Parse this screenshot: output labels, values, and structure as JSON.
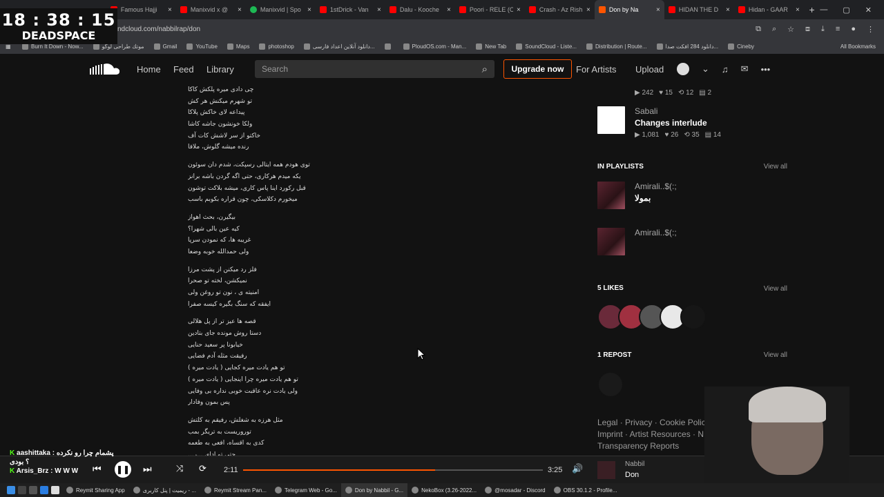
{
  "tabs": [
    {
      "label": "Famous Hajji",
      "icon": "youtube-icon",
      "close": "×"
    },
    {
      "label": "Manixvid x @",
      "icon": "youtube-icon",
      "close": "×"
    },
    {
      "label": "Manixvid | Spo",
      "icon": "spotify-icon",
      "close": "×"
    },
    {
      "label": "1stDrick - Van",
      "icon": "youtube-icon",
      "close": "×"
    },
    {
      "label": "Dalu - Kooche",
      "icon": "youtube-icon",
      "close": "×"
    },
    {
      "label": "Poori - RELE (O",
      "icon": "youtube-icon",
      "close": "×"
    },
    {
      "label": "Crash - Az Rish",
      "icon": "youtube-icon",
      "close": "×"
    },
    {
      "label": "Don by Na",
      "icon": "soundcloud-icon",
      "close": "×",
      "active": true
    },
    {
      "label": "HIDAN THE D",
      "icon": "youtube-icon",
      "close": "×"
    },
    {
      "label": "Hidan - GAAR",
      "icon": "youtube-icon",
      "close": "×"
    }
  ],
  "new_tab": "+",
  "url": "ndcloud.com/nabbilrap/don",
  "bookmarks": [
    "Burn It Down - Now...",
    "موتك طراحی لوگو",
    "Gmail",
    "YouTube",
    "Maps",
    "photoshop",
    "دانلود آنلاین اعداد فارسی...",
    "",
    "PloudOS.com - Man...",
    "New Tab",
    "SoundCloud - Liste...",
    "Distribution | Route...",
    "دانلود 284 افکت صدا...",
    "Cineby"
  ],
  "all_bookmarks": "All Bookmarks",
  "clock": {
    "time": "18 : 38 : 15",
    "label": "DEADSPACE"
  },
  "nav": {
    "home": "Home",
    "feed": "Feed",
    "library": "Library",
    "for_artists": "For Artists",
    "upload": "Upload"
  },
  "search": {
    "placeholder": "Search"
  },
  "upgrade": "Upgrade now",
  "lyrics": [
    [
      "چی دادی میره پلکش کاکا",
      "تو شهرم میکنش هر کش",
      "پیداعه لای خاکش پلاکا",
      "ولکا خونشون جاشه کاشا",
      "خاکتو از سر لاشش کات آف",
      "رنده میشه گلوش، ملافا"
    ],
    [
      "توی هودم همه ایتالی رسپکت، شدم دان سوئون",
      "یکه میدم هرکاری، حتی اگه گردن باشه برانز",
      "قبل رکورد اینا پاس کاری، میشه بلاکت توشون",
      "میخورم دکلاسکی، چون قراره بکوبم باسب"
    ],
    [
      "بیگیرن، بحث اهواز",
      "کیه عین بالی شهرا؟",
      "غریبه ها، که نمودن سرپا",
      "ولی حمدالله خوبه وضعا"
    ],
    [
      "فلز رد میکنن از پشت مرزا",
      "نمیکشن، لخته تو صحرا",
      "امنیته ی ، نون تو روغن ولی",
      "ایفقه که سنگ بگیره کیسه صفرا"
    ],
    [
      "قصه ها عیز تر از پل هلالی",
      "دستا روش مونده جای بتادین",
      "خیابونا پر سعید حنایی",
      "رفیقت مثله آدم فضایی",
      "تو هم یادت میره کجایی ( یادت میره )",
      "تو هم یادت میره چرا اینجایی ( یادت میره )",
      "ولی یادت نره عاقبت خوبی نداره بی وفایی",
      "پس بمون وفادار"
    ],
    [
      "مثل هرزه به شغلش، رفیقم به کلتش",
      "توروریست به تریگر بمب",
      "کدی به اقساه، افعی به طعمه",
      "حتی تو ادای ...ر..."
    ]
  ],
  "top_track": {
    "stats": [
      "242",
      "15",
      "12",
      "2"
    ]
  },
  "related": {
    "artist": "Sabali",
    "title": "Changes interlude",
    "stats": [
      "1,081",
      "26",
      "35",
      "14"
    ]
  },
  "playlists": {
    "heading": "IN PLAYLISTS",
    "view_all": "View all",
    "items": [
      {
        "artist": "Amirali..$(:;",
        "title": "بمولا"
      },
      {
        "artist": "Amirali..$(:;",
        "title": ""
      }
    ]
  },
  "likes": {
    "heading": "5 LIKES",
    "view_all": "View all"
  },
  "reposts": {
    "heading": "1 REPOST",
    "view_all": "View all"
  },
  "footer": {
    "text": "Legal · Privacy · Cookie Polic... Imprint · Artist Resources · N... Transparency Reports"
  },
  "player": {
    "elapsed": "2:11",
    "duration": "3:25",
    "progress_fraction": 0.64,
    "artist": "Nabbil",
    "title": "Don"
  },
  "chat": [
    {
      "badge": "K",
      "text": "aashittaka : پشمام چرا رو نکرده"
    },
    {
      "badge": "؟",
      "text": "بودی"
    },
    {
      "badge": "K",
      "text": "Arsis_Brz : W W W"
    }
  ],
  "taskbar": [
    {
      "label": "Reymit Sharing App"
    },
    {
      "label": "ریمیت | پنل کاربری - ..."
    },
    {
      "label": "Reymit Stream Pan..."
    },
    {
      "label": "Telegram Web - Go..."
    },
    {
      "label": "Don by Nabbil - G...",
      "active": true
    },
    {
      "label": "NekoBox (3.26-2022..."
    },
    {
      "label": "@mosadar - Discord"
    },
    {
      "label": "OBS 30.1.2 - Profile..."
    }
  ],
  "colors": {
    "accent": "#ff5500",
    "bg": "#121212",
    "kick_green": "#53fc18"
  }
}
